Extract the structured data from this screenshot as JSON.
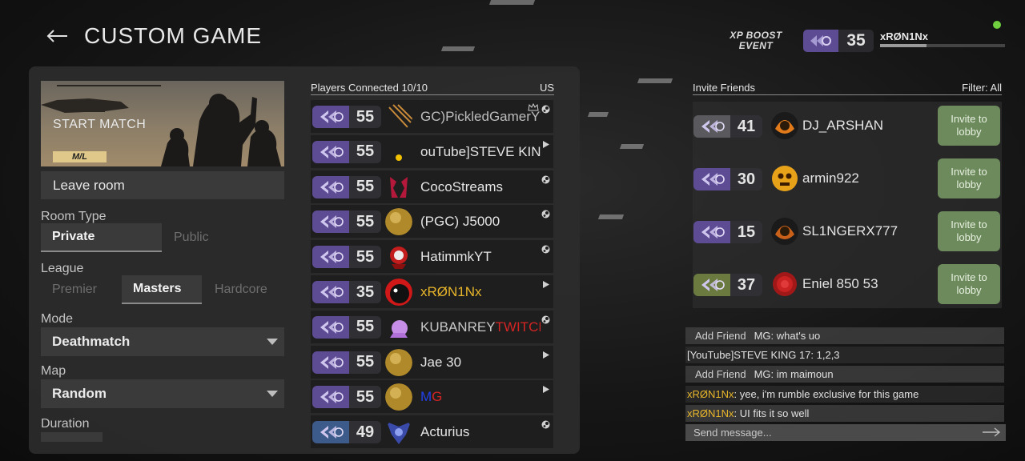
{
  "header": {
    "title": "CUSTOM GAME",
    "xp_boost": "XP BOOST",
    "xp_event": "EVENT",
    "level": "35",
    "username": "xRØN1Nx",
    "xp_progress": 0.37
  },
  "lobby": {
    "start_match": "START MATCH",
    "badge": "M/L",
    "leave_room": "Leave room",
    "room_type_label": "Room Type",
    "room_type_options": [
      "Private",
      "Public"
    ],
    "league_label": "League",
    "league_options": [
      "Premier",
      "Masters",
      "Hardcore"
    ],
    "mode_label": "Mode",
    "mode_value": "Deathmatch",
    "map_label": "Map",
    "map_value": "Random",
    "duration_label": "Duration"
  },
  "players": {
    "header": "Players Connected 10/10",
    "region": "US",
    "rows": [
      {
        "level": "55",
        "name": "GC)PickledGamerYT",
        "name_color": "#bdbdbd",
        "platform": "steam-icon"
      },
      {
        "level": "55",
        "name": "ouTube]STEVE KING",
        "name_color": "#e4e4e4",
        "platform": "play-store-icon"
      },
      {
        "level": "55",
        "name": "CocoStreams",
        "name_color": "#e4e4e4",
        "platform": "steam-icon"
      },
      {
        "level": "55",
        "name": "(PGC) J5000",
        "name_color": "#e4e4e4",
        "platform": "steam-icon"
      },
      {
        "level": "55",
        "name": "HatimmkYT",
        "name_color": "#e4e4e4",
        "platform": "steam-icon"
      },
      {
        "level": "35",
        "name": "xRØN1Nx",
        "name_color": "#e8b52a",
        "platform": "play-store-icon"
      },
      {
        "level": "55",
        "name_a": "KUBANREY",
        "name_b": "TWITCH",
        "platform": "steam-icon"
      },
      {
        "level": "55",
        "name": "Jae 30",
        "name_color": "#e4e4e4",
        "platform": "play-store-icon"
      },
      {
        "level": "55",
        "name_a": "M",
        "name_b": "G",
        "platform": "play-store-icon"
      },
      {
        "level": "49",
        "name": "Acturius",
        "name_color": "#e4e4e4",
        "platform": "steam-icon"
      }
    ]
  },
  "invite": {
    "header": "Invite Friends",
    "filter": "Filter: All",
    "button_line1": "Invite to",
    "button_line2": "lobby",
    "friends": [
      {
        "level": "41",
        "name": "DJ_ARSHAN",
        "rank_color": "#5a5a5e"
      },
      {
        "level": "30",
        "name": "armin922",
        "rank_color": "#5d4b94"
      },
      {
        "level": "15",
        "name": "SL1NGERX777",
        "rank_color": "#5d4b94"
      },
      {
        "level": "37",
        "name": "Eniel 850 53",
        "rank_color": "#6b7a3e"
      }
    ]
  },
  "chat": {
    "add_friend": "Add Friend",
    "lines": [
      {
        "type": "add",
        "text": "MG: what's uo"
      },
      {
        "type": "plain",
        "text": "[YouTube]STEVE KING 17: 1,2,3"
      },
      {
        "type": "add",
        "text": "MG: im maimoun"
      },
      {
        "type": "gold",
        "name": "xRØN1Nx",
        "text": ": yee, i'm rumble exclusive for this game"
      },
      {
        "type": "gold",
        "name": "xRØN1Nx",
        "text": ": UI fits it so well"
      }
    ],
    "placeholder": "Send message..."
  },
  "colors": {
    "accent_green": "#6c8a5c",
    "gold_name": "#e8b52a",
    "rank_purple": "#5d4b94",
    "rank_blue": "#3c5a8a",
    "twitch_red": "#d42424",
    "online": "#6fcf3f"
  }
}
